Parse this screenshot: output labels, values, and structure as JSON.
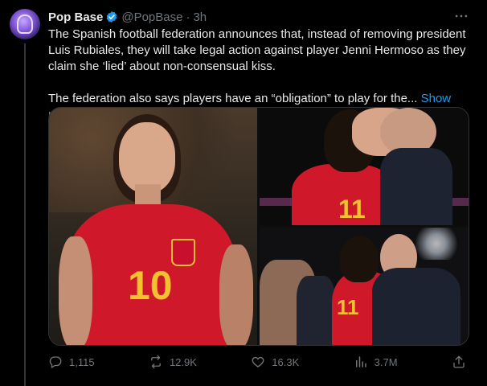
{
  "author": {
    "name": "Pop Base",
    "handle": "@PopBase",
    "time": "3h"
  },
  "icons": {
    "avatar": "pop-base-avatar",
    "verified": "verified-badge-icon",
    "more": "more-icon",
    "reply": "reply-icon",
    "repost": "repost-icon",
    "like": "like-icon",
    "views": "views-icon",
    "share": "share-icon"
  },
  "tweet": {
    "paragraph1": "The Spanish football federation announces that, instead of removing president Luis Rubiales, they will take legal action against player Jenni Hermoso as they claim she ‘lied’ about non-consensual kiss.",
    "paragraph2": "The federation also says players have an “obligation” to play for the...",
    "show_more": "Show more"
  },
  "media": {
    "main_number": "10",
    "top_right_number": "11",
    "bottom_right_number": "11"
  },
  "stats": {
    "replies": "1,115",
    "reposts": "12.9K",
    "likes": "16.3K",
    "views": "3.7M"
  },
  "colors": {
    "accent": "#1d9bf0",
    "text": "#e7e9ea",
    "muted": "#71767b",
    "background": "#000000"
  }
}
